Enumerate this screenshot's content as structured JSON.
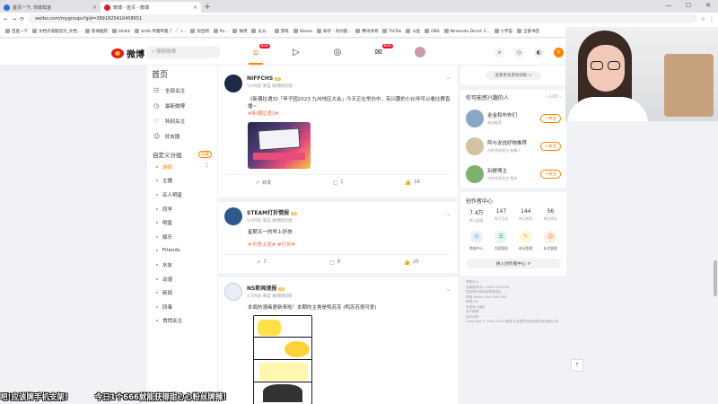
{
  "browser": {
    "tabs": [
      {
        "label": "首页一下, 你就知道"
      },
      {
        "label": "微博 - 首页 - 微博"
      }
    ],
    "new_tab": "+",
    "window_controls": [
      "—",
      "☐",
      "✕"
    ],
    "url": "weibo.com/mygroups?gid=3891825410458651",
    "bookmarks": [
      "百度一下",
      "文档点道题首页_文档...",
      "新闻推荐",
      "bilibili",
      "biliib 哔哩哔哩 (゜-゜)...",
      "淘宝网",
      "Pa...",
      "微博",
      "炎炎...",
      "游戏",
      "Steam",
      "知乎 - 有问题...",
      "腾讯体育",
      "TikTok",
      "斗鱼",
      "OBS",
      "Nintendo Direct 2...",
      "小宇宙",
      "全部书签"
    ]
  },
  "weibo_nav": {
    "logo_text": "微博",
    "search_placeholder": "搜索微博",
    "home_badge": "NEW",
    "message_badge": "NEW"
  },
  "left_nav": {
    "title": "首页",
    "items": [
      {
        "icon": "☷",
        "label": "全部关注"
      },
      {
        "icon": "◷",
        "label": "最新微博"
      },
      {
        "icon": "♡",
        "label": "特别关注"
      },
      {
        "icon": "☺",
        "label": "好友圈"
      }
    ],
    "custom_group_label": "自定义分组",
    "custom_group_action": "设置",
    "groups": [
      {
        "label": "游戏",
        "count": "1"
      },
      {
        "label": "主播"
      },
      {
        "label": "名人明星"
      },
      {
        "label": "同学"
      },
      {
        "label": "明星"
      },
      {
        "label": "娱乐"
      },
      {
        "label": "Friends"
      },
      {
        "label": "水友"
      },
      {
        "label": "动漫"
      },
      {
        "label": "新闻"
      },
      {
        "label": "同事"
      },
      {
        "label": "悄悄关注"
      }
    ]
  },
  "feed": {
    "posts": [
      {
        "name": "NIFFCHS",
        "meta": "5小时前 来自 微博网页版",
        "text": "《新偶拉遇3》「甲子园2023 九州地区大会」今天正在举办中，有兴趣的小伙伴可以看比赛直播~",
        "tags": "#新偶拉遇3#",
        "forward": "转发",
        "comments": "1",
        "likes": "19"
      },
      {
        "name": "STEAM打折情报",
        "meta": "5小时前 来自 微博网页版",
        "text": "星期五一的早上好😎",
        "tags": "#不想上班# #打折#",
        "forward": "7",
        "comments": "8",
        "likes": "25"
      },
      {
        "name": "NS新闻速报",
        "meta": "1小时前 来自 微博网页版",
        "text": "本周的漫画更新来啦！本期的主角是鸭苏苏 (鸭苏苏很可爱)",
        "tags": ""
      }
    ]
  },
  "right": {
    "more_games": "查看更多游戏领取 >",
    "recommend_title": "你可能感兴趣的人",
    "recommend_page": "1/20",
    "recommend": [
      {
        "name": "金金和布布们",
        "desc": "来自推荐",
        "btn": "+关注"
      },
      {
        "name": "阿与说说好物推荐",
        "desc": "与你共同关注 有缘人",
        "btn": "+关注"
      },
      {
        "name": "玩梗博主",
        "desc": "与你共同关注 相关",
        "btn": "+关注"
      }
    ],
    "creator_title": "创作者中心",
    "stats": [
      {
        "v": "7.4万",
        "l": "昨日阅读"
      },
      {
        "v": "147",
        "l": "昨日互动"
      },
      {
        "v": "144",
        "l": "昨日转发"
      },
      {
        "v": "56",
        "l": "昨日评论"
      }
    ],
    "tools": [
      {
        "icon": "◷",
        "label": "数据中心"
      },
      {
        "icon": "☰",
        "label": "内容管理"
      },
      {
        "icon": "✎",
        "label": "粉丝管理"
      },
      {
        "icon": "☺",
        "label": "私信管理"
      }
    ],
    "creator_enter": "进入创作者中心 >",
    "footer": [
      "帮助中心",
      "自助服务中心 4000-100-000",
      "违法和不良信息举报电话",
      "举报 Weibo 4000-960-960",
      "网络110",
      "未成年人保护",
      "关于微博",
      "合作伙伴",
      "Copyright © 2009-2023 微博 北京微梦创科网络技术有限公司"
    ]
  },
  "overlay": {
    "ticker": [
      "吧!应该牌手机支架!",
      "今日1个666就能获得甜心心粉丝牌辣!"
    ]
  },
  "back_to_top": "⇡"
}
